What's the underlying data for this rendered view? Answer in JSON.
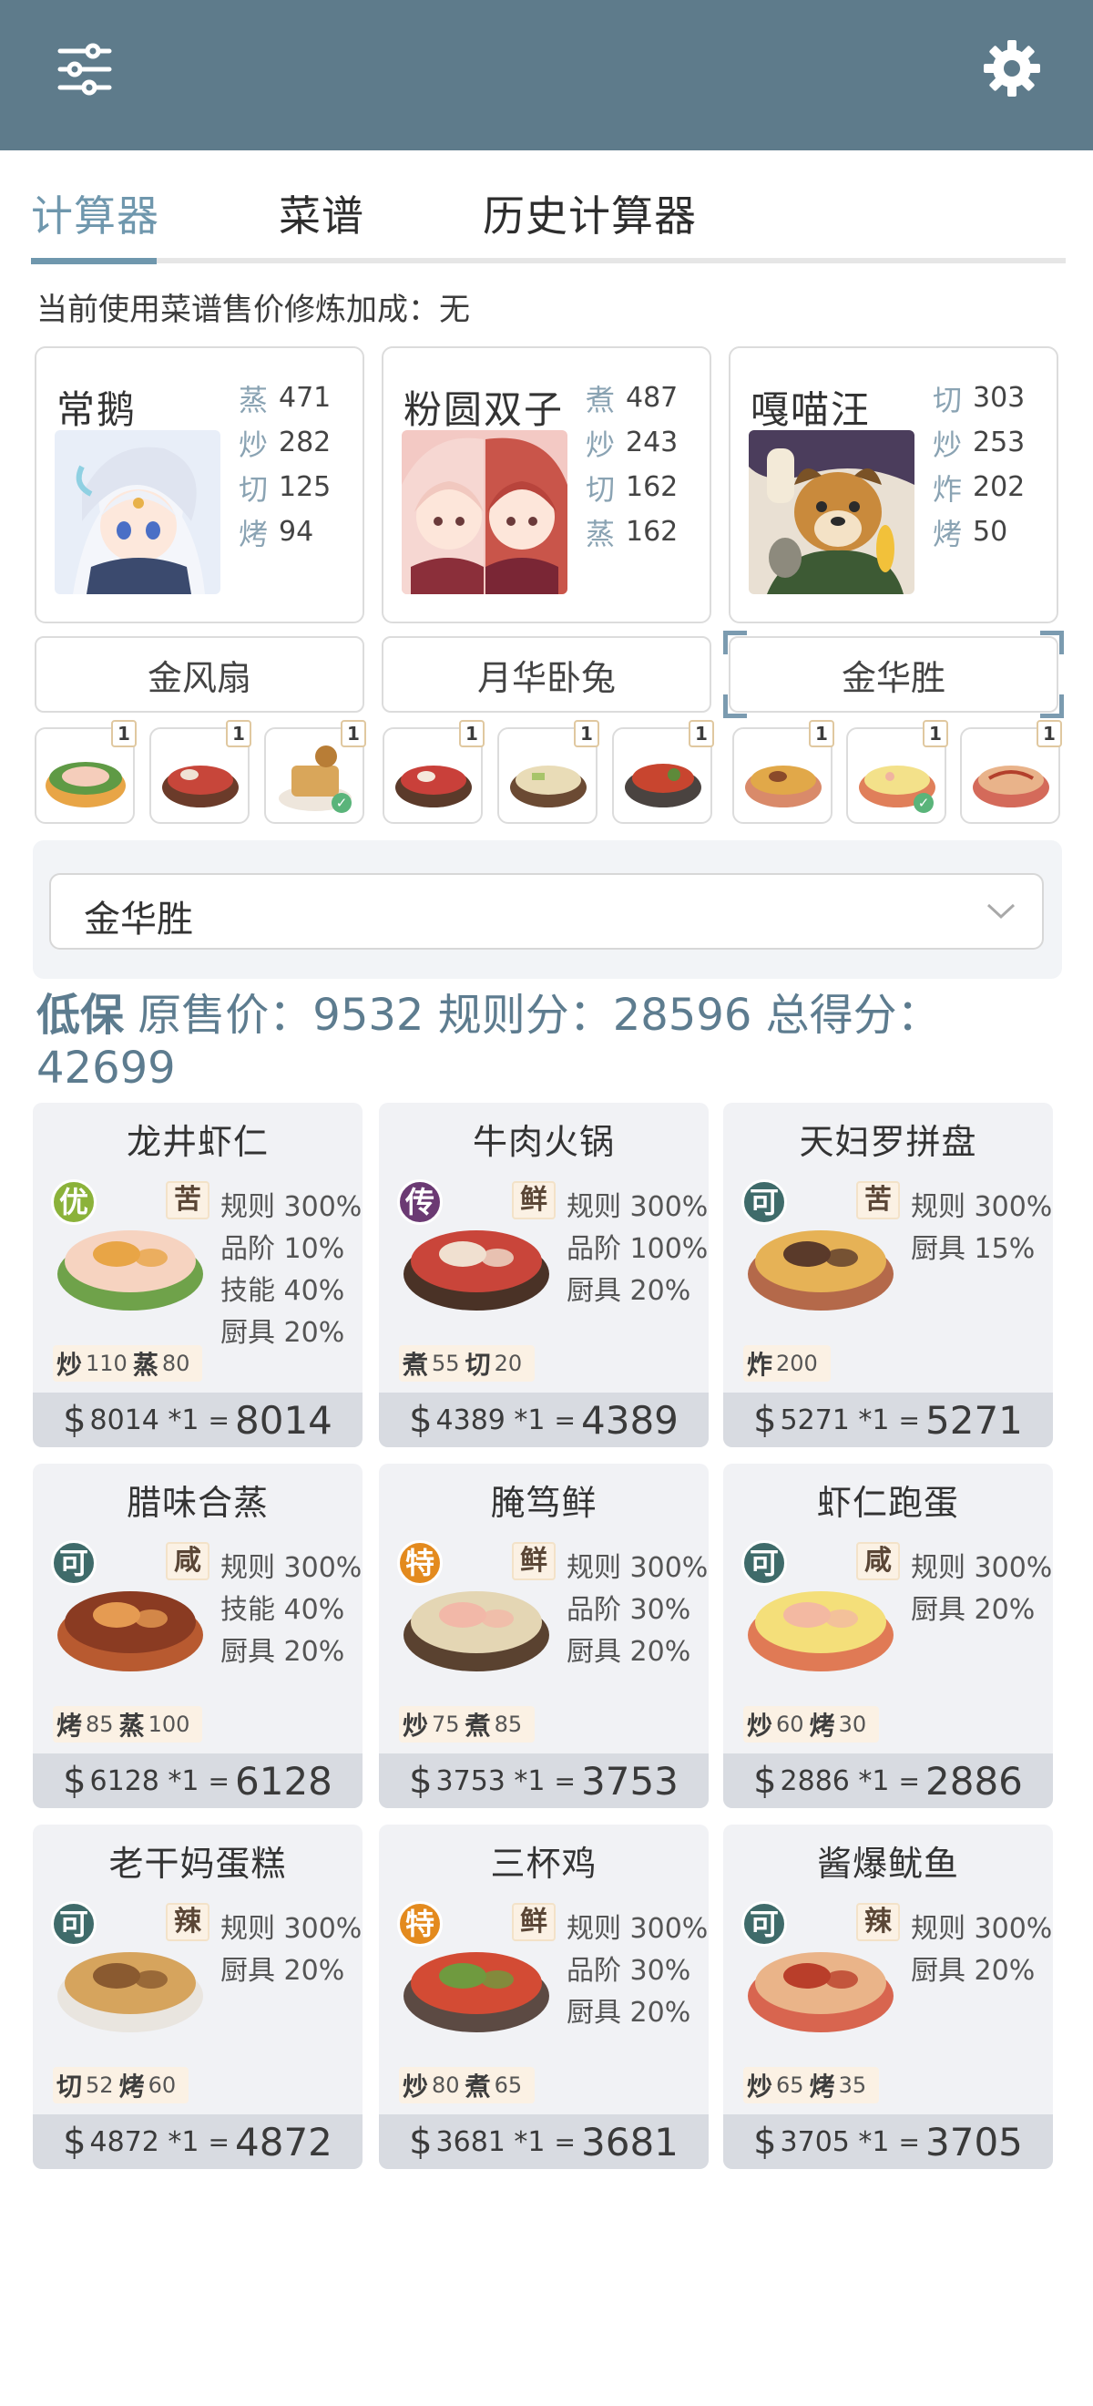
{
  "header": {
    "menu_icon": "sliders-icon",
    "settings_icon": "gear-icon"
  },
  "tabs": [
    {
      "label": "计算器",
      "active": true
    },
    {
      "label": "菜谱",
      "active": false
    },
    {
      "label": "历史计算器",
      "active": false
    }
  ],
  "bonus_line": "当前使用菜谱售价修炼加成：无",
  "chefs": [
    {
      "name": "常鹅",
      "stats": [
        {
          "k": "蒸",
          "v": "471"
        },
        {
          "k": "炒",
          "v": "282"
        },
        {
          "k": "切",
          "v": "125"
        },
        {
          "k": "烤",
          "v": "94"
        }
      ]
    },
    {
      "name": "粉圆双子",
      "stats": [
        {
          "k": "煮",
          "v": "487"
        },
        {
          "k": "炒",
          "v": "243"
        },
        {
          "k": "切",
          "v": "162"
        },
        {
          "k": "蒸",
          "v": "162"
        }
      ]
    },
    {
      "name": "嘎喵汪",
      "stats": [
        {
          "k": "切",
          "v": "303"
        },
        {
          "k": "炒",
          "v": "253"
        },
        {
          "k": "炸",
          "v": "202"
        },
        {
          "k": "烤",
          "v": "50"
        }
      ]
    }
  ],
  "equipment": [
    "金风扇",
    "月华卧兔",
    "金华胜"
  ],
  "thumb_badges": [
    "1",
    "1",
    "1",
    "1",
    "1",
    "1",
    "1",
    "1",
    "1"
  ],
  "select": {
    "value": "金华胜"
  },
  "summary": {
    "low_label": "低保",
    "text": "原售价：9532 规则分：28596 总得分：42699"
  },
  "dishes": [
    {
      "name": "龙井虾仁",
      "rarity": "优",
      "taste": "苦",
      "buffs": [
        "规则 300%",
        "品阶 10%",
        "技能 40%",
        "厨具 20%"
      ],
      "skills": [
        {
          "k": "炒",
          "v": "110"
        },
        {
          "k": "蒸",
          "v": "80"
        }
      ],
      "price": "8014 *1",
      "eq": "=",
      "total": "8014"
    },
    {
      "name": "牛肉火锅",
      "rarity": "传",
      "taste": "鲜",
      "buffs": [
        "规则 300%",
        "品阶 100%",
        "厨具 20%"
      ],
      "skills": [
        {
          "k": "煮",
          "v": "55"
        },
        {
          "k": "切",
          "v": "20"
        }
      ],
      "price": "4389 *1",
      "eq": "=",
      "total": "4389"
    },
    {
      "name": "天妇罗拼盘",
      "rarity": "可",
      "taste": "苦",
      "buffs": [
        "规则 300%",
        "厨具 15%"
      ],
      "skills": [
        {
          "k": "炸",
          "v": "200"
        }
      ],
      "price": "5271 *1",
      "eq": "=",
      "total": "5271"
    },
    {
      "name": "腊味合蒸",
      "rarity": "可",
      "taste": "咸",
      "buffs": [
        "规则 300%",
        "技能 40%",
        "厨具 20%"
      ],
      "skills": [
        {
          "k": "烤",
          "v": "85"
        },
        {
          "k": "蒸",
          "v": "100"
        }
      ],
      "price": "6128 *1",
      "eq": "=",
      "total": "6128"
    },
    {
      "name": "腌笃鲜",
      "rarity": "特",
      "taste": "鲜",
      "buffs": [
        "规则 300%",
        "品阶 30%",
        "厨具 20%"
      ],
      "skills": [
        {
          "k": "炒",
          "v": "75"
        },
        {
          "k": "煮",
          "v": "85"
        }
      ],
      "price": "3753 *1",
      "eq": "=",
      "total": "3753"
    },
    {
      "name": "虾仁跑蛋",
      "rarity": "可",
      "taste": "咸",
      "buffs": [
        "规则 300%",
        "厨具 20%"
      ],
      "skills": [
        {
          "k": "炒",
          "v": "60"
        },
        {
          "k": "烤",
          "v": "30"
        }
      ],
      "price": "2886 *1",
      "eq": "=",
      "total": "2886"
    },
    {
      "name": "老干妈蛋糕",
      "rarity": "可",
      "taste": "辣",
      "buffs": [
        "规则 300%",
        "厨具 20%"
      ],
      "skills": [
        {
          "k": "切",
          "v": "52"
        },
        {
          "k": "烤",
          "v": "60"
        }
      ],
      "price": "4872 *1",
      "eq": "=",
      "total": "4872"
    },
    {
      "name": "三杯鸡",
      "rarity": "特",
      "taste": "鲜",
      "buffs": [
        "规则 300%",
        "品阶 30%",
        "厨具 20%"
      ],
      "skills": [
        {
          "k": "炒",
          "v": "80"
        },
        {
          "k": "煮",
          "v": "65"
        }
      ],
      "price": "3681 *1",
      "eq": "=",
      "total": "3681"
    },
    {
      "name": "酱爆鱿鱼",
      "rarity": "可",
      "taste": "辣",
      "buffs": [
        "规则 300%",
        "厨具 20%"
      ],
      "skills": [
        {
          "k": "炒",
          "v": "65"
        },
        {
          "k": "烤",
          "v": "35"
        }
      ],
      "price": "3705 *1",
      "eq": "=",
      "total": "3705"
    }
  ],
  "rarity_colors": {
    "优": "#8bb23a",
    "传": "#6b3a73",
    "可": "#3f6b6a",
    "特": "#e38a1e"
  },
  "dollar_sign": "$"
}
